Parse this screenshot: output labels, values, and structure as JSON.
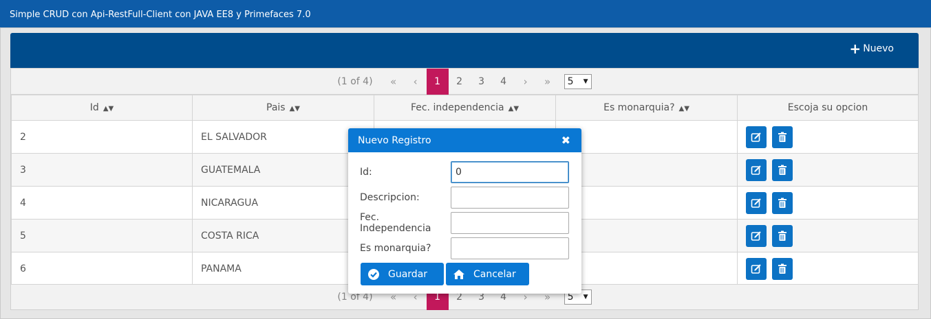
{
  "app": {
    "title": "Simple CRUD con Api-RestFull-Client con JAVA EE8 y Primefaces 7.0"
  },
  "toolbar": {
    "new_label": "Nuevo",
    "new_icon": "plus-icon"
  },
  "paginator": {
    "current_report": "(1 of 4)",
    "pages": [
      "1",
      "2",
      "3",
      "4"
    ],
    "active_page": "1",
    "rows_per_page": "5",
    "first": "«",
    "prev": "‹",
    "next": "›",
    "last": "»"
  },
  "table": {
    "columns": [
      {
        "label": "Id",
        "sortable": true
      },
      {
        "label": "Pais",
        "sortable": true
      },
      {
        "label": "Fec. independencia",
        "sortable": true
      },
      {
        "label": "Es monarquia?",
        "sortable": true
      },
      {
        "label": "Escoja su opcion",
        "sortable": false
      }
    ],
    "rows": [
      {
        "id": "2",
        "pais": "EL SALVADOR",
        "fecha": "",
        "monarquia": ""
      },
      {
        "id": "3",
        "pais": "GUATEMALA",
        "fecha": "",
        "monarquia": ""
      },
      {
        "id": "4",
        "pais": "NICARAGUA",
        "fecha": "",
        "monarquia": ""
      },
      {
        "id": "5",
        "pais": "COSTA RICA",
        "fecha": "",
        "monarquia": ""
      },
      {
        "id": "6",
        "pais": "PANAMA",
        "fecha": "",
        "monarquia": ""
      }
    ],
    "row_actions": [
      "edit-icon",
      "trash-icon"
    ]
  },
  "dialog": {
    "title": "Nuevo Registro",
    "fields": [
      {
        "label": "Id:",
        "value": "0"
      },
      {
        "label": "Descripcion:",
        "value": ""
      },
      {
        "label": "Fec. Independencia",
        "value": ""
      },
      {
        "label": "Es monarquia?",
        "value": ""
      }
    ],
    "save_label": "Guardar",
    "cancel_label": "Cancelar"
  },
  "colors": {
    "header": "#0e5ca8",
    "toolbar": "#004c8c",
    "active_page": "#c2185b",
    "button": "#0a78d4"
  }
}
